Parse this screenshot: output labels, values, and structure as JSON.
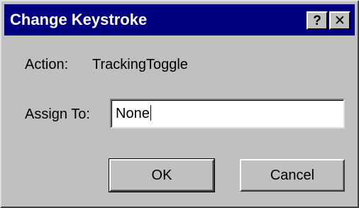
{
  "window": {
    "title": "Change Keystroke",
    "help_glyph": "?",
    "close_glyph": "✕"
  },
  "action": {
    "label": "Action:",
    "value": "TrackingToggle"
  },
  "assign": {
    "label": "Assign To:",
    "value": "None"
  },
  "buttons": {
    "ok": "OK",
    "cancel": "Cancel"
  },
  "icons": {
    "help": "help-icon",
    "close": "close-icon"
  },
  "colors": {
    "titlebar": "#000080",
    "face": "#c0c0c0",
    "input_bg": "#ffffff"
  }
}
